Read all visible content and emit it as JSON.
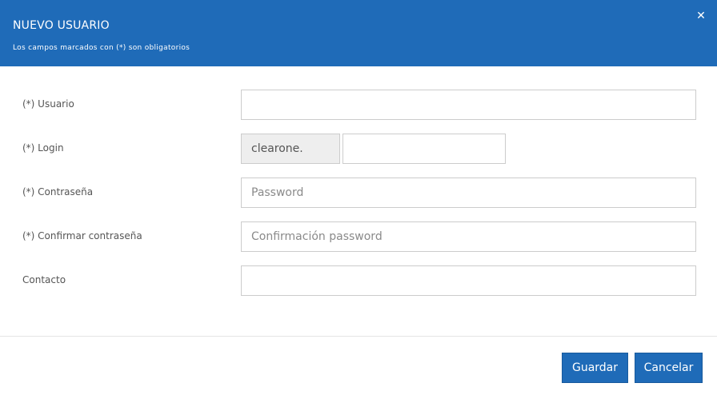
{
  "header": {
    "title": "NUEVO USUARIO",
    "subtitle": "Los campos marcados con (*) son obligatorios",
    "close_glyph": "✕"
  },
  "form": {
    "usuario": {
      "label": "(*) Usuario",
      "value": "",
      "placeholder": ""
    },
    "login": {
      "label": "(*) Login",
      "prefix": "clearone.",
      "value": "",
      "placeholder": ""
    },
    "password": {
      "label": "(*) Contraseña",
      "value": "",
      "placeholder": "Password"
    },
    "confirm": {
      "label": "(*) Confirmar contraseña",
      "value": "",
      "placeholder": "Confirmación password"
    },
    "contacto": {
      "label": "Contacto",
      "value": "",
      "placeholder": ""
    }
  },
  "footer": {
    "save_label": "Guardar",
    "cancel_label": "Cancelar"
  },
  "colors": {
    "primary": "#1f6bb8",
    "addon_bg": "#eeeeee",
    "border": "#cccccc"
  }
}
